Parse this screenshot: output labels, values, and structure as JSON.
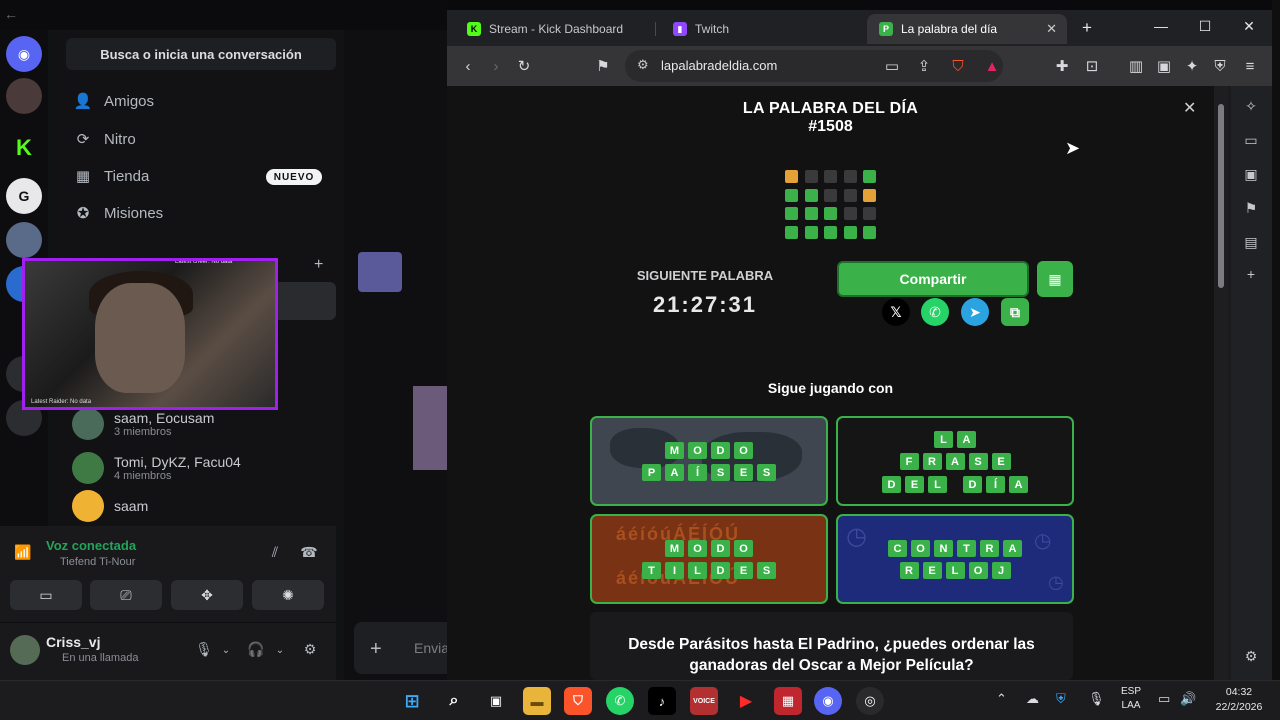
{
  "discord": {
    "search_label": "Busca o inicia una conversación",
    "nav": [
      {
        "label": "Amigos",
        "icon": "friends-icon"
      },
      {
        "label": "Nitro",
        "icon": "nitro-icon"
      },
      {
        "label": "Tienda",
        "icon": "shop-icon"
      },
      {
        "label": "Misiones",
        "icon": "quests-icon"
      }
    ],
    "new_badge": "NUEVO",
    "dms": [
      {
        "name": "Tomi, DyKZ, Facu04",
        "sub": "4 miembros"
      },
      {
        "name": "saam",
        "sub": ""
      }
    ],
    "dm_partial": {
      "name": "saam, Eocusam",
      "sub": "3 miembros"
    },
    "webcam_overlay_top": "Latest cheer: No data",
    "webcam_overlay_bottom": "Latest Raider: No data",
    "voice": {
      "title": "Voz conectada",
      "channel": "Tiefend Ti-Nour"
    },
    "user": {
      "name": "Criss_vj",
      "status": "En una llamada"
    },
    "chat_placeholder": "Envia"
  },
  "browser": {
    "tabs": [
      {
        "label": "Stream - Kick Dashboard",
        "icon": "kick-icon",
        "active": false
      },
      {
        "label": "Twitch",
        "icon": "twitch-icon",
        "active": false
      },
      {
        "label": "La palabra del día",
        "icon": "palabra-icon",
        "active": true
      }
    ],
    "url": "lapalabradeldia.com"
  },
  "game": {
    "title": "LA PALABRA DEL DÍA",
    "number": "#1508",
    "grid": [
      [
        "yellow",
        "dark",
        "dark",
        "dark",
        "green"
      ],
      [
        "green",
        "green",
        "dark",
        "dark",
        "yellow"
      ],
      [
        "green",
        "green",
        "green",
        "dark",
        "dark"
      ],
      [
        "green",
        "green",
        "green",
        "green",
        "green"
      ]
    ],
    "colors": {
      "green": "#3bb14a",
      "yellow": "#e3a137",
      "dark": "#3a3a3d"
    },
    "next_word_label": "SIGUIENTE PALABRA",
    "countdown": "21:27:31",
    "share_label": "Compartir",
    "keep_playing": "Sigue jugando con",
    "modes": [
      {
        "rows": [
          "MODO",
          "PAÍSES"
        ],
        "name": "modo-paises"
      },
      {
        "rows": [
          "LA",
          "FRASE",
          "DEL DÍA"
        ],
        "name": "la-frase-del-dia"
      },
      {
        "rows": [
          "MODO",
          "TILDES"
        ],
        "name": "modo-tildes",
        "deco": "áéíóúÁÉÍÓÚ"
      },
      {
        "rows": [
          "CONTRA",
          "RELOJ"
        ],
        "name": "contra-reloj"
      }
    ],
    "promo": "Desde Parásitos hasta El Padrino, ¿puedes ordenar las ganadoras del Oscar a Mejor Película?"
  },
  "taskbar": {
    "lang": [
      "ESP",
      "LAA"
    ],
    "time": "04:32",
    "date": "22/2/2026"
  }
}
